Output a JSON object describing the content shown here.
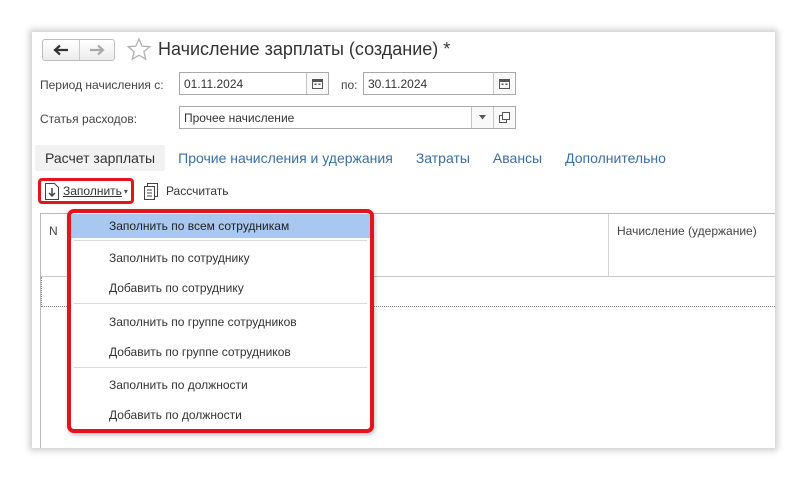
{
  "header": {
    "title": "Начисление зарплаты (создание) *",
    "back_glyph": "🡐",
    "forward_glyph": "🡒"
  },
  "period": {
    "from_label": "Период начисления с:",
    "from_value": "01.11.2024",
    "to_label": "по:",
    "to_value": "30.11.2024"
  },
  "expense": {
    "label": "Статья расходов:",
    "value": "Прочее начисление"
  },
  "tabs": [
    {
      "label": "Расчет зарплаты",
      "active": true
    },
    {
      "label": "Прочие начисления и удержания",
      "active": false
    },
    {
      "label": "Затраты",
      "active": false
    },
    {
      "label": "Авансы",
      "active": false
    },
    {
      "label": "Дополнительно",
      "active": false
    }
  ],
  "toolbar": {
    "fill_label": "Заполнить",
    "calc_label": "Рассчитать"
  },
  "grid": {
    "col_n": "N",
    "col_accrual": "Начисление (удержание)"
  },
  "menu": {
    "items": [
      "Заполнить по всем сотрудникам",
      "Заполнить по сотруднику",
      "Добавить по сотруднику",
      "Заполнить по группе сотрудников",
      "Добавить по группе сотрудников",
      "Заполнить по должности",
      "Добавить по должности"
    ],
    "highlighted_index": 0
  },
  "colors": {
    "highlight_red": "#e3141b",
    "menu_highlight": "#a8c8f0",
    "link_blue": "#3a6ea5"
  }
}
